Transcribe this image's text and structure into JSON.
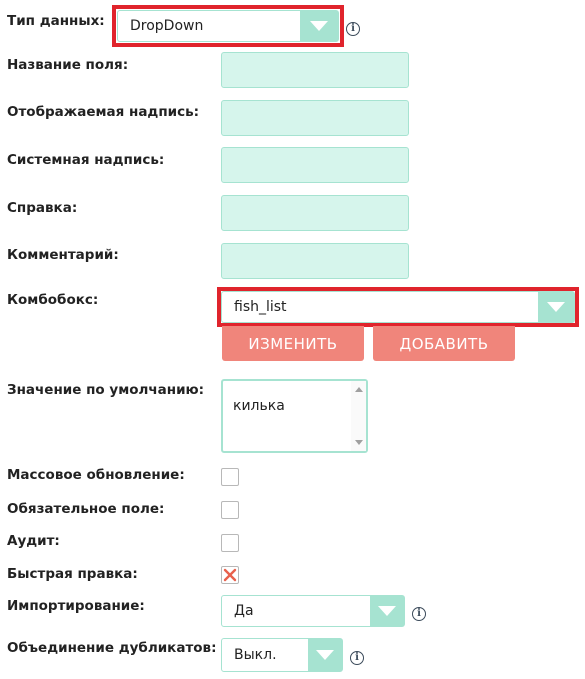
{
  "fields": {
    "data_type": {
      "label": "Тип данных:",
      "value": "DropDown",
      "info_icon": "info-icon"
    },
    "field_name": {
      "label": "Название поля:",
      "value": ""
    },
    "display_label": {
      "label": "Отображаемая надпись:",
      "value": ""
    },
    "system_label": {
      "label": "Системная надпись:",
      "value": ""
    },
    "help": {
      "label": "Справка:",
      "value": ""
    },
    "comment": {
      "label": "Комментарий:",
      "value": ""
    },
    "combobox": {
      "label": "Комбобокс:",
      "value": "fish_list",
      "edit_button": "ИЗМЕНИТЬ",
      "add_button": "ДОБАВИТЬ"
    },
    "default_value": {
      "label": "Значение по умолчанию:",
      "value": "килька"
    },
    "mass_update": {
      "label": "Массовое обновление:",
      "checked": false
    },
    "required": {
      "label": "Обязательное поле:",
      "checked": false
    },
    "audit": {
      "label": "Аудит:",
      "checked": false
    },
    "quick_edit": {
      "label": "Быстрая правка:",
      "checked": true
    },
    "importing": {
      "label": "Импортирование:",
      "value": "Да"
    },
    "merge_duplicates": {
      "label": "Объединение дубликатов:",
      "value": "Выкл."
    }
  },
  "colors": {
    "input_bg": "#d6f5ec",
    "input_border": "#a6e3d1",
    "button_bg": "#f0857b",
    "highlight": "#e0242c",
    "check_mark": "#e8604c"
  }
}
